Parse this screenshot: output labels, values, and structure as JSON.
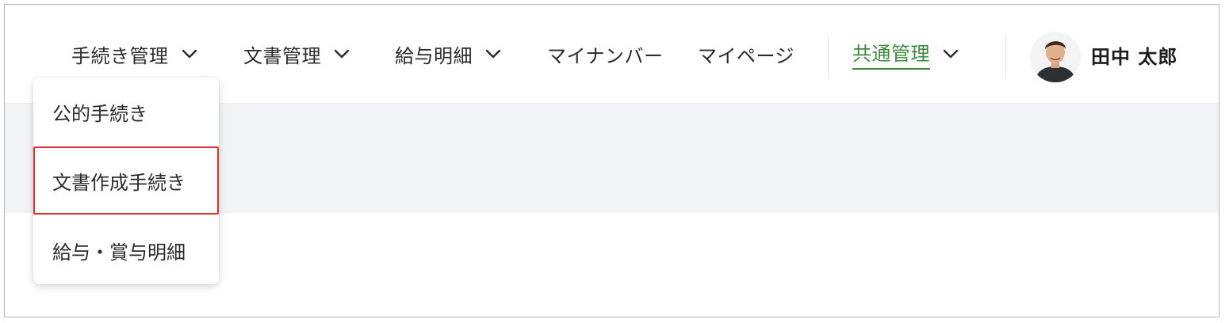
{
  "nav": {
    "items": [
      {
        "label": "手続き管理",
        "has_dropdown": true
      },
      {
        "label": "文書管理",
        "has_dropdown": true
      },
      {
        "label": "給与明細",
        "has_dropdown": true
      },
      {
        "label": "マイナンバー",
        "has_dropdown": false
      },
      {
        "label": "マイページ",
        "has_dropdown": false
      },
      {
        "label": "共通管理",
        "has_dropdown": true,
        "active": true
      }
    ]
  },
  "user": {
    "name": "田中 太郎"
  },
  "dropdown": {
    "items": [
      {
        "label": "公的手続き"
      },
      {
        "label": "文書作成手続き",
        "highlighted": true
      },
      {
        "label": "給与・賞与明細"
      }
    ]
  },
  "colors": {
    "accent_green": "#3c8a3c",
    "highlight_red": "#e0352b",
    "band_gray": "#f2f3f5"
  }
}
